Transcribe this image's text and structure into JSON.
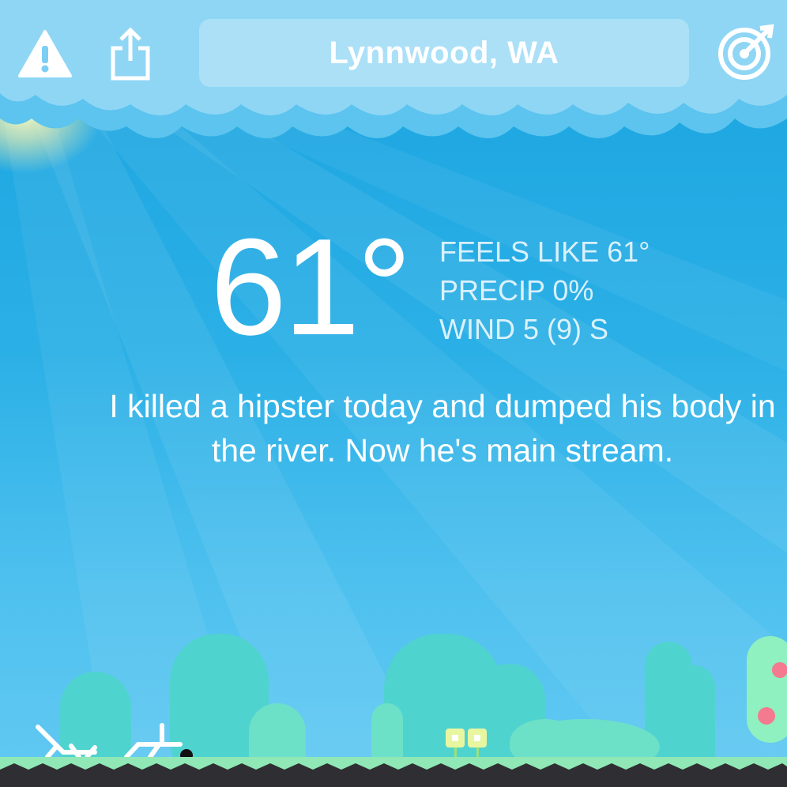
{
  "header": {
    "location": "Lynnwood, WA",
    "alert_icon": "warning-triangle-icon",
    "share_icon": "share-icon",
    "locate_icon": "target-locate-icon"
  },
  "current": {
    "temperature": "61°",
    "feels_like": "FEELS LIKE 61°",
    "precip": "PRECIP 0%",
    "wind": "WIND 5 (9) S"
  },
  "message": "I killed a hipster today and dumped his body in the river. Now he's main stream.",
  "colors": {
    "sky": "#1ea8e2",
    "cloud": "#8fd6f5",
    "hill": "#4fd3cf",
    "grass": "#8fe8b5",
    "tree": "#8ff0c0",
    "fruit": "#f47a8f"
  }
}
